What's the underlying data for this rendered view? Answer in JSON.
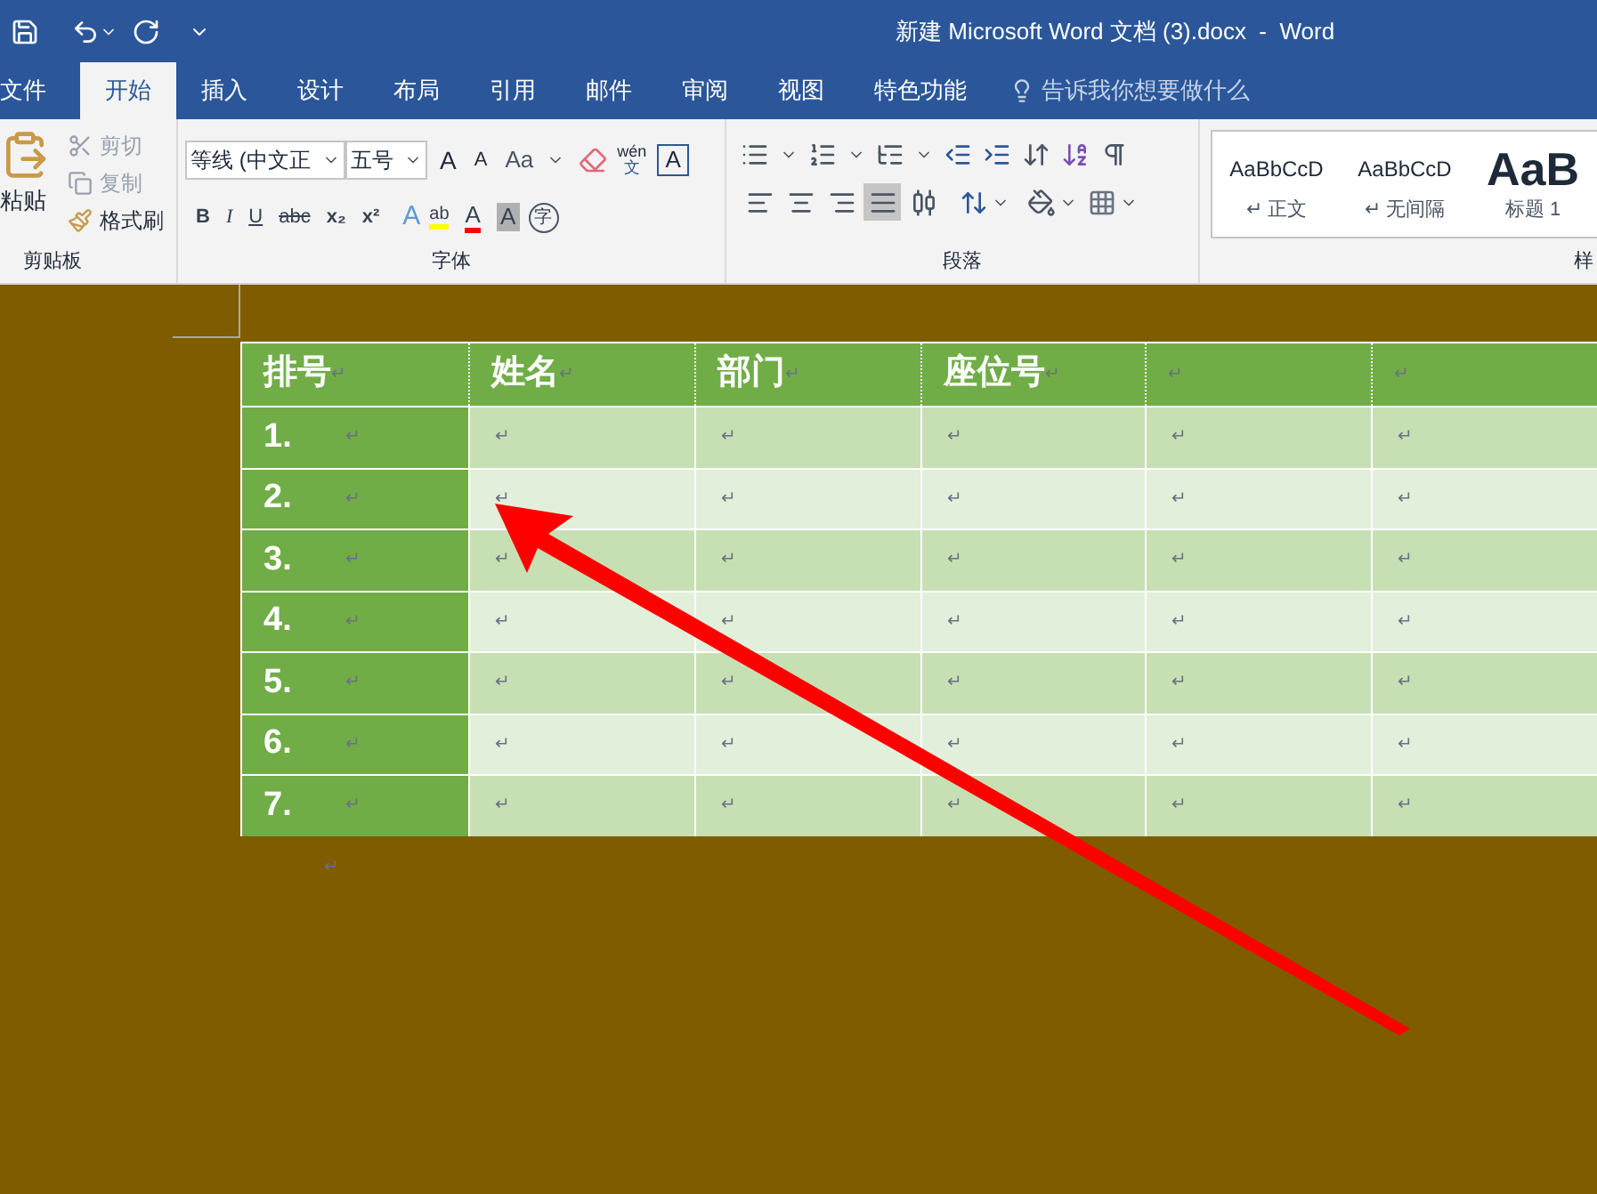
{
  "window": {
    "title": "新建 Microsoft Word 文档 (3).docx  -  Word"
  },
  "tabs": [
    {
      "label": "文件",
      "selected": false
    },
    {
      "label": "开始",
      "selected": true
    },
    {
      "label": "插入",
      "selected": false
    },
    {
      "label": "设计",
      "selected": false
    },
    {
      "label": "布局",
      "selected": false
    },
    {
      "label": "引用",
      "selected": false
    },
    {
      "label": "邮件",
      "selected": false
    },
    {
      "label": "审阅",
      "selected": false
    },
    {
      "label": "视图",
      "selected": false
    },
    {
      "label": "特色功能",
      "selected": false
    }
  ],
  "tell_me": {
    "placeholder": "告诉我你想要做什么"
  },
  "clipboard": {
    "paste": "粘贴",
    "cut": "剪切",
    "copy": "复制",
    "format_painter": "格式刷",
    "group": "剪贴板"
  },
  "font": {
    "family": "等线 (中文正",
    "size": "五号",
    "grow": "A",
    "shrink": "A",
    "case": "Aa",
    "phonetic_top": "wén",
    "phonetic_bottom": "文",
    "border": "A",
    "format_buttons": [
      "B",
      "I",
      "U",
      "abc",
      "x₂",
      "x²"
    ],
    "effect": "A",
    "highlight": "ab",
    "font_color": "A",
    "shading": "A",
    "enclose": "字",
    "group": "字体"
  },
  "paragraph": {
    "group": "段落",
    "align": [
      {
        "kind": "left",
        "selected": false
      },
      {
        "kind": "center",
        "selected": false
      },
      {
        "kind": "right",
        "selected": false
      },
      {
        "kind": "justify",
        "selected": true
      },
      {
        "kind": "distributed",
        "selected": false
      }
    ]
  },
  "styles": {
    "items": [
      {
        "preview": "AaBbCcD",
        "label": "↵ 正文",
        "kind": "normal"
      },
      {
        "preview": "AaBbCcD",
        "label": "↵ 无间隔",
        "kind": "normal"
      },
      {
        "preview": "AaB",
        "label": "标题 1",
        "kind": "heading"
      }
    ],
    "group": "样"
  },
  "table": {
    "header": [
      {
        "text": "排号",
        "mark": "↵"
      },
      {
        "text": "姓名",
        "mark": "↵"
      },
      {
        "text": "部门",
        "mark": "↵"
      },
      {
        "text": "座位号",
        "mark": "↵"
      },
      {
        "mark": "↵"
      },
      {
        "mark": "↵"
      }
    ],
    "rows": [
      {
        "label": "1.",
        "marks": [
          "↵",
          "↵",
          "↵",
          "↵",
          "↵",
          "↵"
        ]
      },
      {
        "label": "2.",
        "marks": [
          "↵",
          "↵",
          "↵",
          "↵",
          "↵",
          "↵"
        ]
      },
      {
        "label": "3.",
        "marks": [
          "↵",
          "↵",
          "↵",
          "↵",
          "↵",
          "↵"
        ]
      },
      {
        "label": "4.",
        "marks": [
          "↵",
          "↵",
          "↵",
          "↵",
          "↵",
          "↵"
        ]
      },
      {
        "label": "5.",
        "marks": [
          "↵",
          "↵",
          "↵",
          "↵",
          "↵",
          "↵"
        ]
      },
      {
        "label": "6.",
        "marks": [
          "↵",
          "↵",
          "↵",
          "↵",
          "↵",
          "↵"
        ]
      },
      {
        "label": "7.",
        "marks": [
          "↵",
          "↵",
          "↵",
          "↵",
          "↵",
          "↵"
        ]
      }
    ]
  },
  "trailing_mark": "↵"
}
